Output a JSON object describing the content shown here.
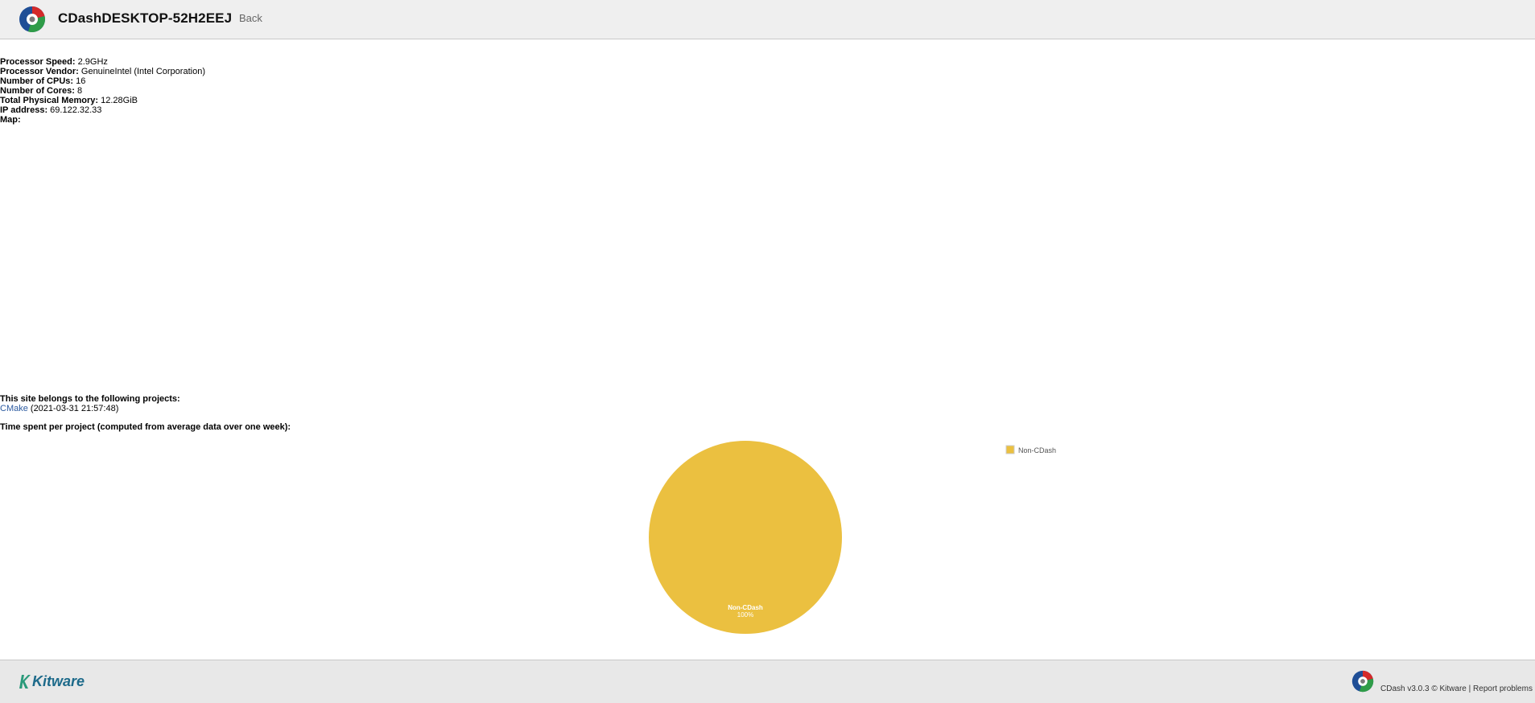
{
  "header": {
    "site_title": "CDashDESKTOP-52H2EEJ",
    "back_label": "Back"
  },
  "site_info": [
    {
      "label": "Processor Speed:",
      "value": "2.9GHz"
    },
    {
      "label": "Processor Vendor:",
      "value": "GenuineIntel (Intel Corporation)"
    },
    {
      "label": "Number of CPUs:",
      "value": "16"
    },
    {
      "label": "Number of Cores:",
      "value": "8"
    },
    {
      "label": "Total Physical Memory:",
      "value": "12.28GiB"
    },
    {
      "label": "IP address:",
      "value": "69.122.32.33"
    },
    {
      "label": "Map:",
      "value": ""
    }
  ],
  "projects": {
    "heading": "This site belongs to the following projects:",
    "items": [
      {
        "name": "CMake",
        "date": "(2021-03-31 21:57:48)"
      }
    ]
  },
  "time_heading": "Time spent per project (computed from average data over one week):",
  "chart_data": {
    "type": "pie",
    "title": "",
    "slices": [
      {
        "label": "Non-CDash",
        "value": 100,
        "display": "100%",
        "color": "#ebc040"
      }
    ],
    "legend": {
      "position": "top-right",
      "entries": [
        "Non-CDash"
      ]
    }
  },
  "footer": {
    "brand": "Kitware",
    "version_text": "CDash v3.0.3 © ",
    "kitware_link": "Kitware",
    "separator": " | ",
    "report_link": "Report problems"
  },
  "colors": {
    "header_bg": "#efefef",
    "footer_bg": "#e8e8e8",
    "link": "#2c5aa0",
    "pie_fill": "#ebc040"
  }
}
